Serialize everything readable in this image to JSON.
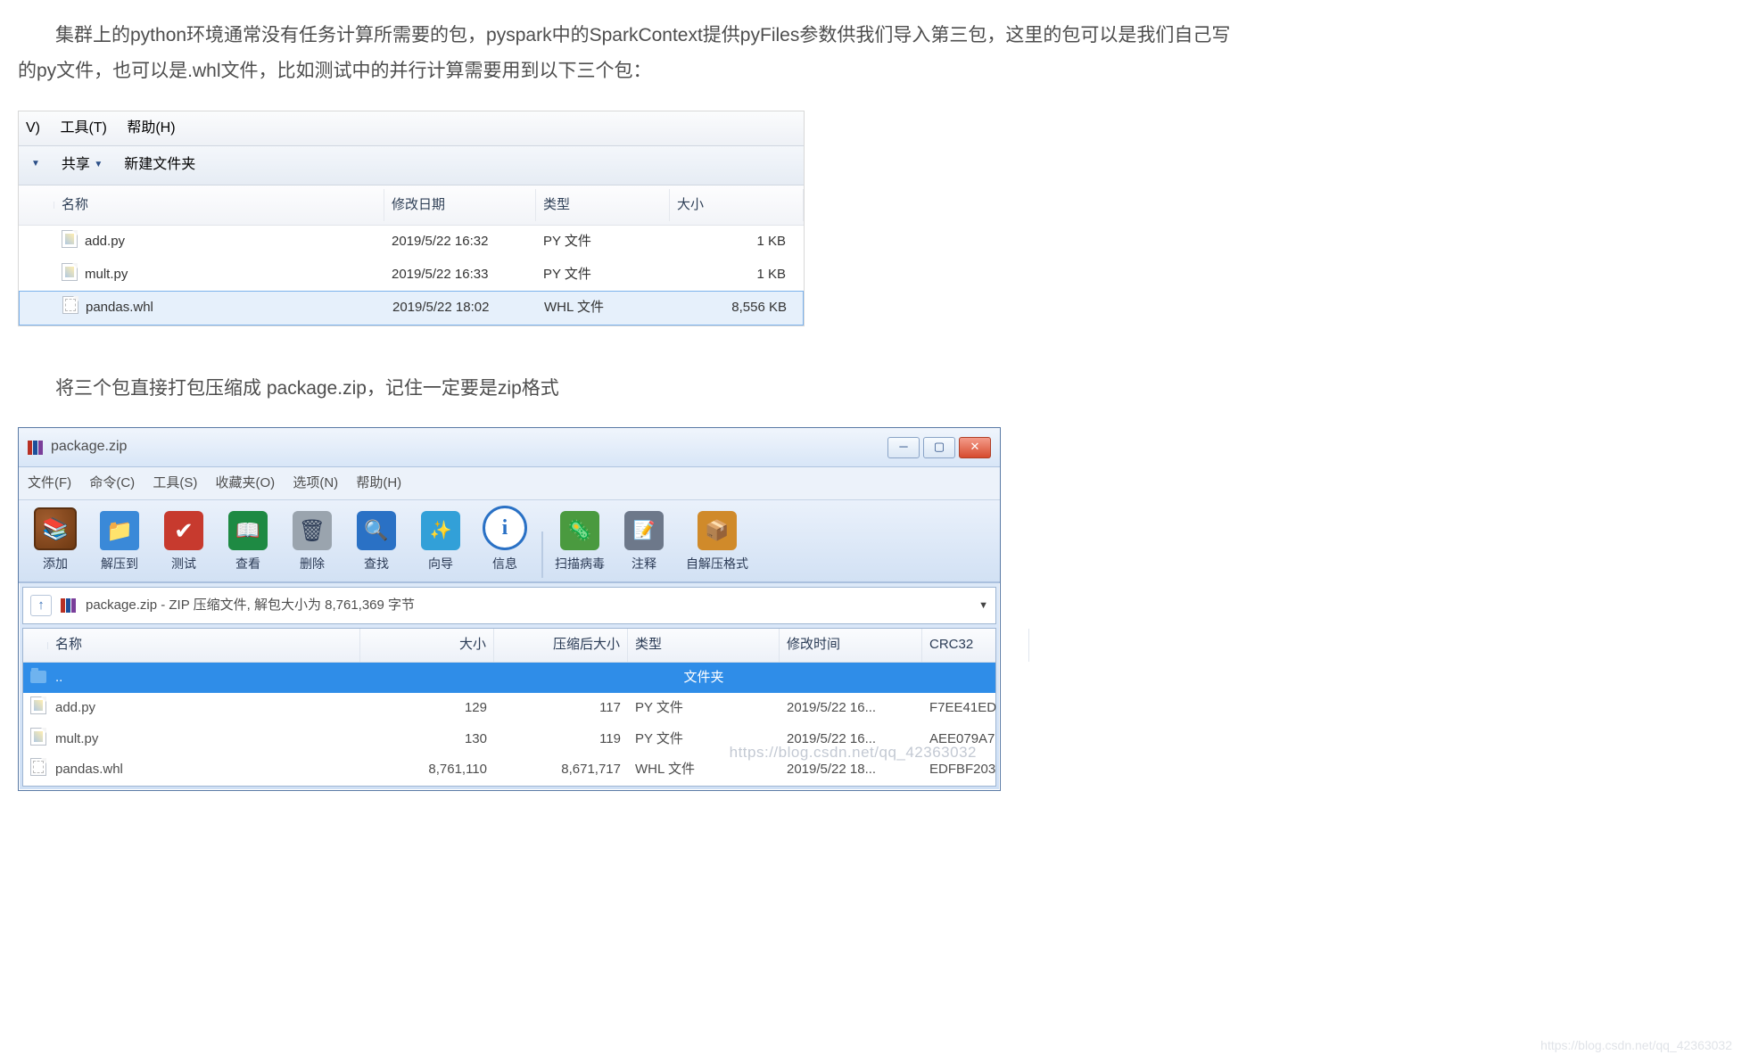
{
  "article": {
    "para1": "集群上的python环境通常没有任务计算所需要的包，pyspark中的SparkContext提供pyFiles参数供我们导入第三包，这里的包可以是我们自己写的py文件，也可以是.whl文件，比如测试中的并行计算需要用到以下三个包：",
    "para2": "将三个包直接打包压缩成 package.zip，记住一定要是zip格式"
  },
  "explorer": {
    "menubar": {
      "v": "V)",
      "tools": "工具(T)",
      "help": "帮助(H)"
    },
    "toolbar": {
      "share": "共享",
      "newfolder": "新建文件夹"
    },
    "headers": {
      "name": "名称",
      "date": "修改日期",
      "type": "类型",
      "size": "大小"
    },
    "rows": [
      {
        "icon": "py",
        "name": "add.py",
        "date": "2019/5/22 16:32",
        "type": "PY 文件",
        "size": "1 KB",
        "sel": false
      },
      {
        "icon": "py",
        "name": "mult.py",
        "date": "2019/5/22 16:33",
        "type": "PY 文件",
        "size": "1 KB",
        "sel": false
      },
      {
        "icon": "whl",
        "name": "pandas.whl",
        "date": "2019/5/22 18:02",
        "type": "WHL 文件",
        "size": "8,556 KB",
        "sel": true
      }
    ]
  },
  "winrar": {
    "title": "package.zip",
    "menubar": {
      "file": "文件(F)",
      "cmd": "命令(C)",
      "tool": "工具(S)",
      "fav": "收藏夹(O)",
      "opt": "选项(N)",
      "help": "帮助(H)"
    },
    "toolbar": [
      {
        "icon": "ic-add",
        "label": "添加"
      },
      {
        "icon": "ic-extract",
        "label": "解压到"
      },
      {
        "icon": "ic-test",
        "label": "测试"
      },
      {
        "icon": "ic-view",
        "label": "查看"
      },
      {
        "icon": "ic-del",
        "label": "删除"
      },
      {
        "icon": "ic-find",
        "label": "查找"
      },
      {
        "icon": "ic-wiz",
        "label": "向导"
      },
      {
        "icon": "ic-info",
        "label": "信息"
      },
      {
        "sep": true
      },
      {
        "icon": "ic-virus",
        "label": "扫描病毒"
      },
      {
        "icon": "ic-cmt",
        "label": "注释"
      },
      {
        "icon": "ic-sfx",
        "label": "自解压格式",
        "wide": true
      }
    ],
    "path": "package.zip - ZIP 压缩文件, 解包大小为 8,761,369 字节",
    "headers": {
      "name": "名称",
      "size": "大小",
      "packed": "压缩后大小",
      "type": "类型",
      "date": "修改时间",
      "crc": "CRC32"
    },
    "parent": {
      "name": "..",
      "type": "文件夹"
    },
    "rows": [
      {
        "icon": "py",
        "name": "add.py",
        "size": "129",
        "packed": "117",
        "type": "PY 文件",
        "date": "2019/5/22 16...",
        "crc": "F7EE41ED"
      },
      {
        "icon": "py",
        "name": "mult.py",
        "size": "130",
        "packed": "119",
        "type": "PY 文件",
        "date": "2019/5/22 16...",
        "crc": "AEE079A7"
      },
      {
        "icon": "whl",
        "name": "pandas.whl",
        "size": "8,761,110",
        "packed": "8,671,717",
        "type": "WHL 文件",
        "date": "2019/5/22 18...",
        "crc": "EDFBF203"
      }
    ],
    "watermark": "https://blog.csdn.net/qq_42363032"
  },
  "footer_mark": "https://blog.csdn.net/qq_42363032"
}
